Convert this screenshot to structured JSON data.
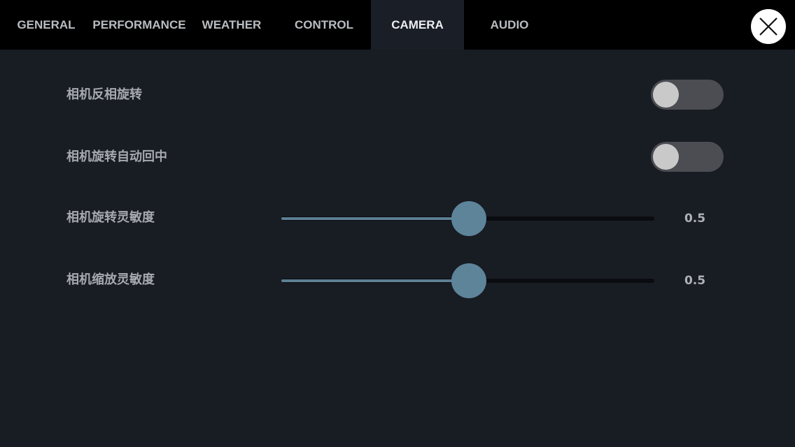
{
  "tabs": [
    {
      "label": "GENERAL",
      "active": false
    },
    {
      "label": "PERFORMANCE",
      "active": false
    },
    {
      "label": "WEATHER",
      "active": false
    },
    {
      "label": "CONTROL",
      "active": false
    },
    {
      "label": "CAMERA",
      "active": true
    },
    {
      "label": "AUDIO",
      "active": false
    }
  ],
  "close_icon": "close-x-icon",
  "settings": {
    "invert_rotation": {
      "label": "相机反相旋转",
      "on": false
    },
    "auto_center": {
      "label": "相机旋转自动回中",
      "on": false
    },
    "rotation_sensitivity": {
      "label": "相机旋转灵敏度",
      "value": 0.5,
      "display": "0.5"
    },
    "zoom_sensitivity": {
      "label": "相机缩放灵敏度",
      "value": 0.5,
      "display": "0.5"
    }
  },
  "colors": {
    "background": "#181c23",
    "tab_bar": "#000000",
    "active_tab": "#1a1f27",
    "slider_accent": "#5e849a",
    "toggle_off_track": "#4b4d52"
  }
}
